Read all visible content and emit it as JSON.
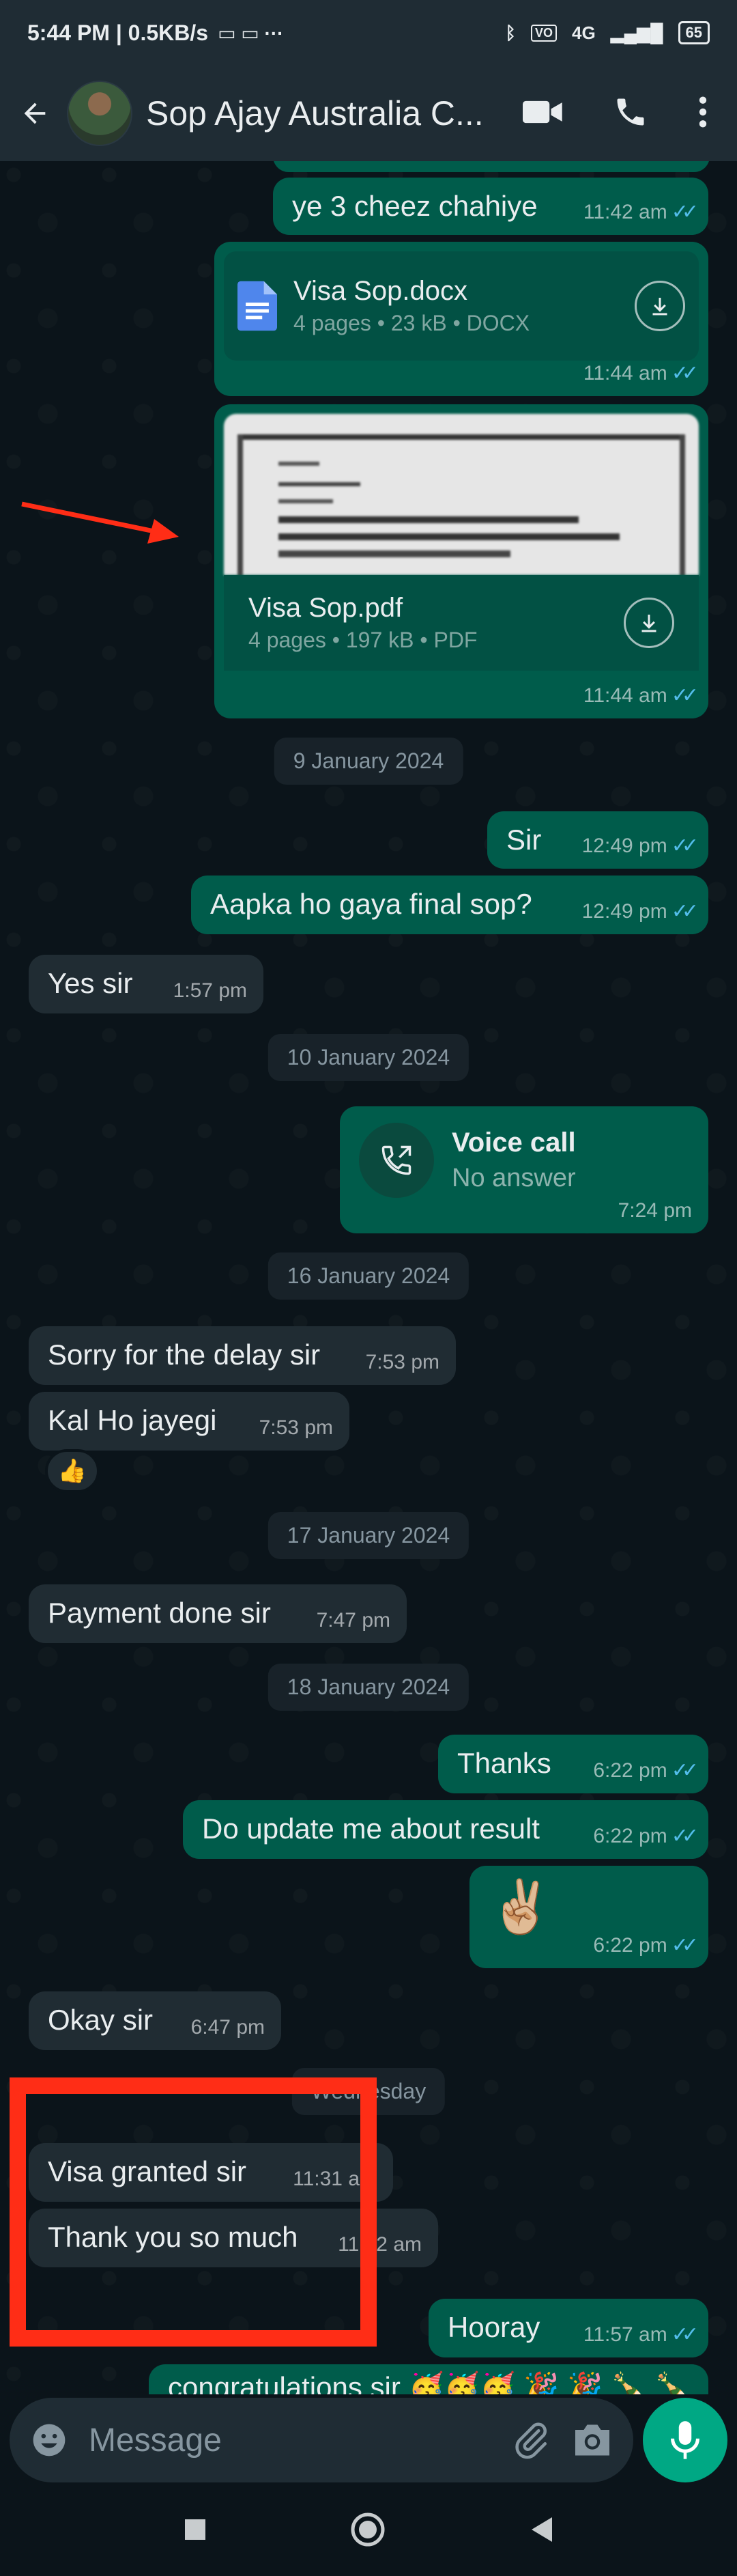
{
  "status_bar": {
    "time": "5:44 PM | 0.5KB/s",
    "network": "4G",
    "battery": "65"
  },
  "header": {
    "title": "Sop Ajay Australia C..."
  },
  "messages": {
    "m1": {
      "text": "ye 3 cheez chahiye",
      "time": "11:42 am"
    },
    "doc1": {
      "name": "Visa Sop.docx",
      "meta": "4 pages • 23 kB • DOCX",
      "time": "11:44 am"
    },
    "doc2": {
      "name": "Visa Sop.pdf",
      "meta": "4 pages • 197 kB • PDF",
      "time": "11:44 am"
    },
    "date1": "9 January 2024",
    "m2": {
      "text": "Sir",
      "time": "12:49 pm"
    },
    "m3": {
      "text": "Aapka ho gaya final sop?",
      "time": "12:49 pm"
    },
    "m4": {
      "text": "Yes sir",
      "time": "1:57 pm"
    },
    "date2": "10 January 2024",
    "call": {
      "title": "Voice call",
      "status": "No answer",
      "time": "7:24 pm"
    },
    "date3": "16 January 2024",
    "m5": {
      "text": "Sorry for the delay sir",
      "time": "7:53 pm"
    },
    "m6": {
      "text": "Kal Ho jayegi",
      "time": "7:53 pm",
      "reaction": "👍"
    },
    "date4": "17 January 2024",
    "m7": {
      "text": "Payment done sir",
      "time": "7:47 pm"
    },
    "date5": "18 January 2024",
    "m8": {
      "text": "Thanks",
      "time": "6:22 pm"
    },
    "m9": {
      "text": "Do update me about result",
      "time": "6:22 pm"
    },
    "m10": {
      "text": "✌🏼",
      "time": "6:22 pm"
    },
    "m11": {
      "text": "Okay sir",
      "time": "6:47 pm"
    },
    "date6": "Wednesday",
    "m12": {
      "text": "Visa granted sir",
      "time": "11:31 am"
    },
    "m13": {
      "text": "Thank you so much",
      "time": "11:32 am"
    },
    "m14": {
      "text": "Hooray",
      "time": "11:57 am"
    },
    "m15": {
      "text": "congratulations sir 🥳🥳🥳 🎉 🎉 🍾 🍾"
    }
  },
  "input": {
    "placeholder": "Message"
  },
  "colors": {
    "outgoing": "#005c4b",
    "incoming": "#202c33",
    "accent": "#00a884",
    "annotation": "#ff2d16"
  }
}
